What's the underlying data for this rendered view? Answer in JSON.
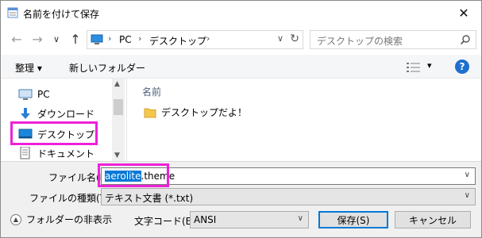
{
  "window": {
    "title": "名前を付けて保存",
    "close_label": "✕"
  },
  "nav": {
    "back_label": "←",
    "forward_label": "→",
    "recent_label": "∨",
    "up_label": "↑",
    "address": {
      "crumbs": [
        "PC",
        "デスクトップ"
      ],
      "separator": "›",
      "dropdown": "∨",
      "refresh": "↻"
    },
    "search": {
      "placeholder": "デスクトップの検索"
    }
  },
  "toolbar": {
    "organize_label": "整理 ▾",
    "new_folder_label": "新しいフォルダー",
    "view_dropdown": "▾",
    "help_label": "?"
  },
  "nav_pane": {
    "items": [
      {
        "label": "PC",
        "icon": "pc-icon"
      },
      {
        "label": "ダウンロード",
        "icon": "download-icon"
      },
      {
        "label": "デスクトップ",
        "icon": "desktop-icon",
        "selected": true
      },
      {
        "label": "ドキュメント",
        "icon": "document-icon"
      }
    ],
    "scroll_up": "▲",
    "scroll_down": "▼"
  },
  "content": {
    "column_header": "名前",
    "files": [
      {
        "name": "デスクトップだよ！",
        "icon": "folder-icon"
      }
    ]
  },
  "form": {
    "filename_label": "ファイル名(N):",
    "filename_selected": "aerolite",
    "filename_rest": ".theme",
    "filetype_label": "ファイルの種類(T):",
    "filetype_value": "テキスト文書 (*.txt)",
    "encoding_label": "文字コード(E):",
    "encoding_value": "ANSI",
    "save_label": "保存(S)",
    "cancel_label": "キャンセル",
    "hide_folders_label": "フォルダーの非表示",
    "dropdown_arrow": "∨"
  },
  "colors": {
    "highlight": "#ee21d8",
    "selection": "#0078d7",
    "nav_selected": "#cce8ff"
  }
}
